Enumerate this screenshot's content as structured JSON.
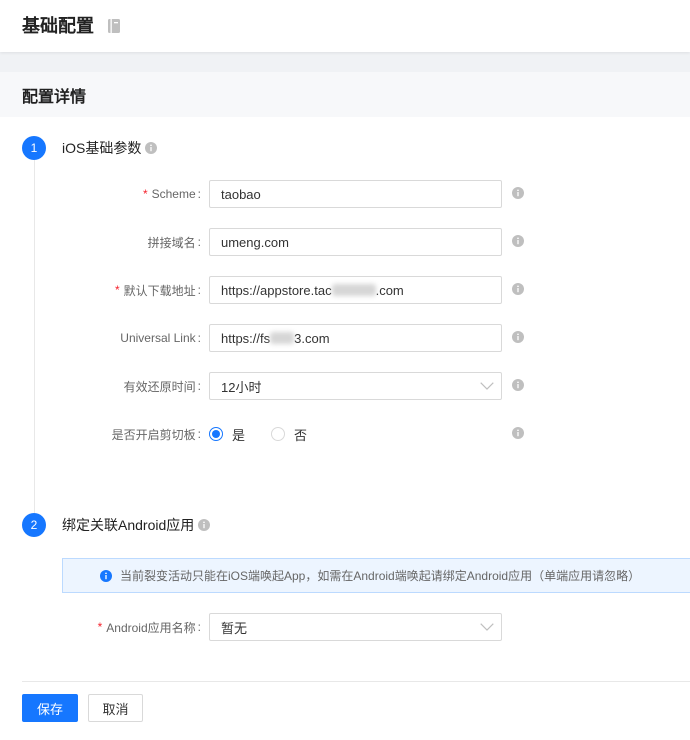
{
  "colors": {
    "primary": "#1677ff",
    "required": "#f5222d",
    "text": "#333333",
    "label": "#666666",
    "muted_icon": "#bfbfbf",
    "border": "#d9d9d9",
    "alert_bg": "#edf5ff",
    "alert_border": "#bcdaff",
    "page_bg": "#f0f2f5",
    "card_header_bg": "#f7f8fa",
    "divider": "#e8e8e8"
  },
  "header": {
    "title": "基础配置",
    "icon": "document-icon"
  },
  "section": {
    "title": "配置详情"
  },
  "form_marks": {
    "required": "*",
    "colon": ":"
  },
  "steps": [
    {
      "number": "1",
      "title": "iOS基础参数",
      "title_icon": "info-icon",
      "fields": {
        "scheme": {
          "label": "Scheme",
          "required": true,
          "value": "taobao",
          "help_icon": "info-icon"
        },
        "domain": {
          "label": "拼接域名",
          "required": false,
          "value": "umeng.com",
          "help_icon": "info-icon"
        },
        "download_url": {
          "label": "默认下载地址",
          "required": true,
          "value_prefix": "https://appstore.tac",
          "value_redacted": true,
          "value_suffix": ".com",
          "help_icon": "info-icon"
        },
        "universal_link": {
          "label": "Universal Link",
          "required": false,
          "value_prefix": "https://fs",
          "value_redacted": true,
          "value_suffix": "3.com",
          "help_icon": "info-icon"
        },
        "restore_time": {
          "label": "有效还原时间",
          "required": false,
          "value": "12小时",
          "dropdown_icon": "chevron-down-icon",
          "help_icon": "info-icon"
        },
        "clipboard": {
          "label": "是否开启剪切板",
          "required": false,
          "options": [
            "是",
            "否"
          ],
          "selected_index": 0,
          "help_icon": "info-icon"
        }
      }
    },
    {
      "number": "2",
      "title": "绑定关联Android应用",
      "title_icon": "info-icon",
      "notice": {
        "icon": "info-icon",
        "text": "当前裂变活动只能在iOS端唤起App，如需在Android端唤起请绑定Android应用（单端应用请忽略）"
      },
      "fields": {
        "android_app": {
          "label": "Android应用名称",
          "required": true,
          "value": "暂无",
          "dropdown_icon": "chevron-down-icon"
        }
      }
    }
  ],
  "actions": {
    "save": "保存",
    "cancel": "取消"
  }
}
